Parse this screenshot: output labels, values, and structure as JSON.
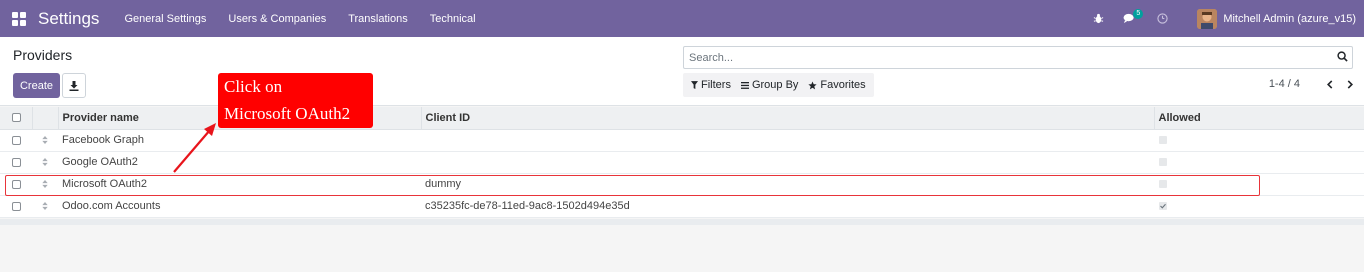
{
  "navbar": {
    "app_title": "Settings",
    "menu": [
      "General Settings",
      "Users & Companies",
      "Translations",
      "Technical"
    ],
    "chat_count": "5",
    "user_name": "Mitchell Admin (azure_v15)"
  },
  "control_panel": {
    "breadcrumb": "Providers",
    "create_label": "Create",
    "search_placeholder": "Search...",
    "filters_label": "Filters",
    "group_by_label": "Group By",
    "favorites_label": "Favorites",
    "pager_value": "1-4 / 4"
  },
  "table": {
    "columns": [
      "Provider name",
      "Client ID",
      "Allowed"
    ],
    "rows": [
      {
        "name": "Facebook Graph",
        "client_id": "",
        "allowed": false
      },
      {
        "name": "Google OAuth2",
        "client_id": "",
        "allowed": false
      },
      {
        "name": "Microsoft OAuth2",
        "client_id": "dummy",
        "allowed": false
      },
      {
        "name": "Odoo.com Accounts",
        "client_id": "c35235fc-de78-11ed-9ac8-1502d494e35d",
        "allowed": true
      }
    ]
  },
  "annotation": {
    "line1": "Click on",
    "line2": "Microsoft OAuth2"
  },
  "colors": {
    "brand": "#71639e",
    "annotation": "#ff0000"
  }
}
